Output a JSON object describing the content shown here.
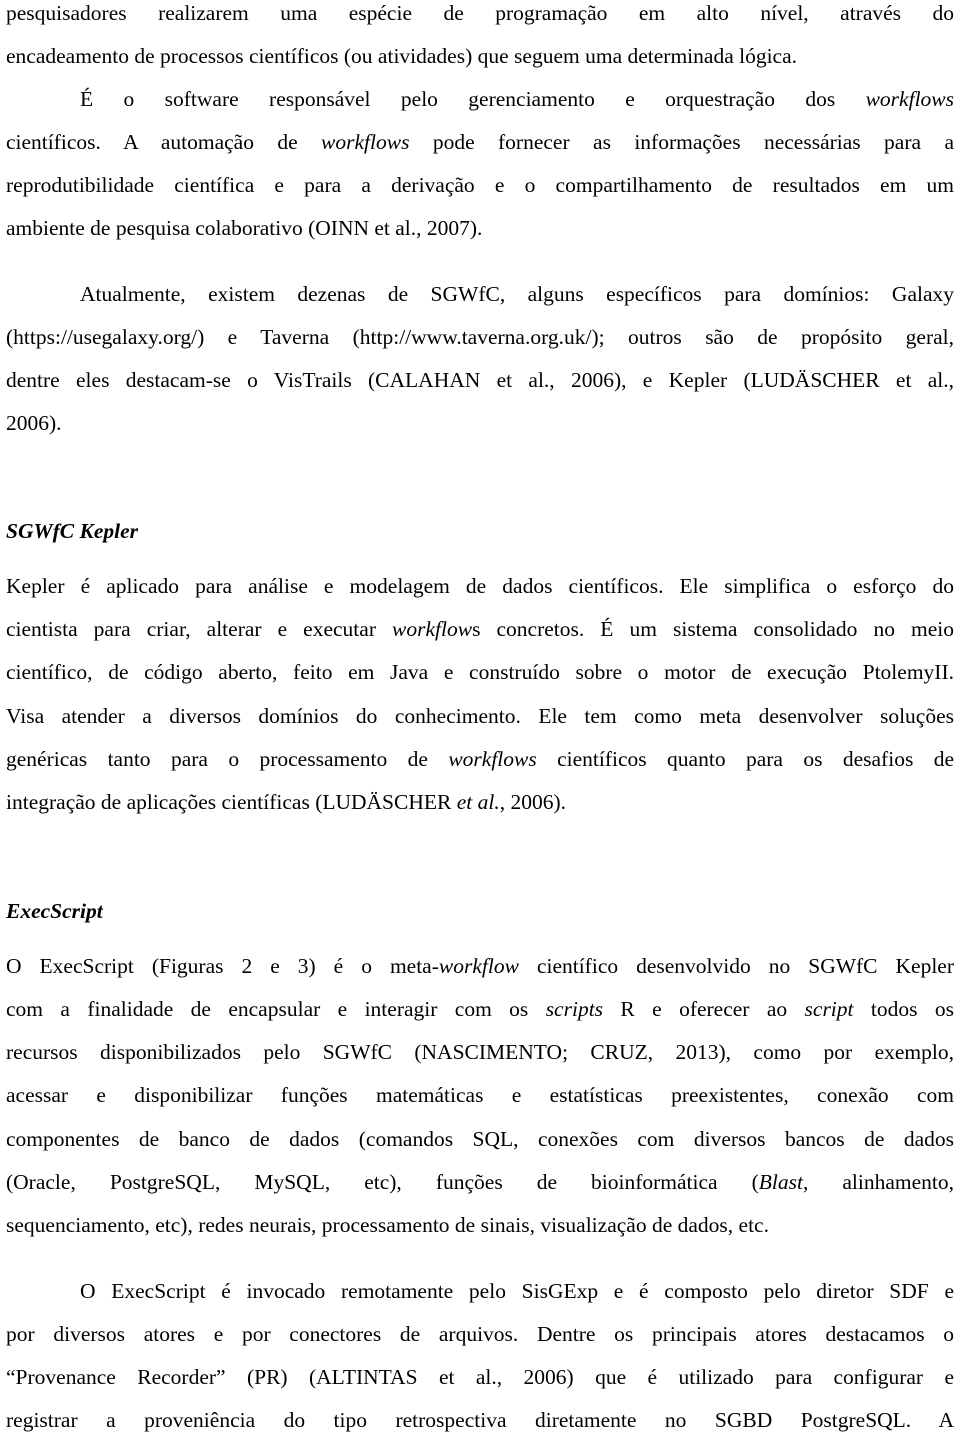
{
  "paragraph1": {
    "lines": [
      "pesquisadores realizarem uma espécie de programação em alto nível, através do",
      "encadeamento de processos científicos (ou atividades) que seguem uma determinada lógica."
    ]
  },
  "paragraph2": {
    "l1_a": "É o software responsável pelo gerenciamento e orquestração dos ",
    "l1_em": "workflows",
    "l2_a": "científicos. A automação de ",
    "l2_em": "workflows",
    "l2_b": " pode fornecer as informações necessárias para a",
    "l3": "reprodutibilidade científica e para a derivação e o compartilhamento de resultados em um",
    "l4": "ambiente de pesquisa colaborativo (OINN et al., 2007)."
  },
  "paragraph3": {
    "lines": [
      "Atualmente, existem dezenas de SGWfC, alguns específicos para domínios: Galaxy",
      "(https://usegalaxy.org/) e Taverna (http://www.taverna.org.uk/); outros são de propósito geral,",
      "dentre eles destacam-se o VisTrails (CALAHAN et al., 2006), e Kepler (LUDÄSCHER et al.,",
      "2006)."
    ]
  },
  "heading_kepler": "SGWfC Kepler",
  "kepler": {
    "l1": "Kepler é aplicado para análise e modelagem de dados científicos. Ele simplifica o esforço do",
    "l2_a": "cientista para criar, alterar e executar ",
    "l2_em": "workflow",
    "l2_b": "s concretos. É um sistema consolidado no meio",
    "l3": "científico, de código aberto, feito em Java e construído sobre o motor de execução PtolemyII.",
    "l4": "Visa atender a diversos domínios do conhecimento. Ele tem como meta desenvolver soluções",
    "l5_a": "genéricas tanto para o processamento de ",
    "l5_em": "workflows",
    "l5_b": " científicos quanto para os desafios de",
    "l6_a": "integração de aplicações científicas (LUDÄSCHER ",
    "l6_em": "et al.",
    "l6_b": ", 2006)."
  },
  "heading_execscript": "ExecScript",
  "exec": {
    "l1_a": "O ExecScript (Figuras 2 e 3) é o meta-",
    "l1_em": "workflow",
    "l1_b": " científico desenvolvido no SGWfC Kepler",
    "l2_a": "com a finalidade de encapsular e interagir com os ",
    "l2_em1": "scripts",
    "l2_b": " R e oferecer ao ",
    "l2_em2": "script",
    "l2_c": " todos os",
    "l3": "recursos disponibilizados pelo SGWfC (NASCIMENTO; CRUZ, 2013), como por exemplo,",
    "l4": "acessar e disponibilizar funções matemáticas e estatísticas preexistentes, conexão com",
    "l5": "componentes de banco de dados (comandos SQL, conexões com diversos bancos de dados",
    "l6_a": "(Oracle, PostgreSQL, MySQL, etc), funções de bioinformática (",
    "l6_em": "Blast",
    "l6_b": ", alinhamento,",
    "l7": "sequenciamento, etc), redes neurais, processamento de sinais, visualização de dados, etc."
  },
  "exec2": {
    "lines": [
      "O ExecScript é invocado remotamente pelo SisGExp e é composto pelo diretor SDF e",
      "por diversos atores e por conectores de arquivos. Dentre os principais atores destacamos o",
      "“Provenance Recorder” (PR) (ALTINTAS et al., 2006) que é utilizado para configurar e",
      "registrar a proveniência do tipo retrospectiva diretamente no SGBD PostgreSQL. A"
    ]
  }
}
